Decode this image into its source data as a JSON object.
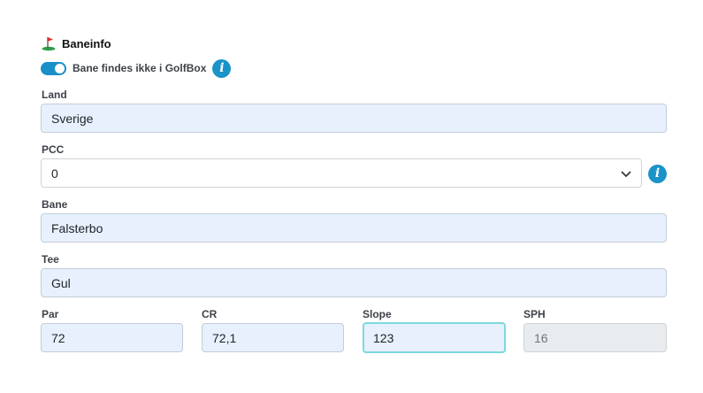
{
  "section": {
    "title": "Baneinfo",
    "icon": "golf-flag-icon"
  },
  "toggle": {
    "label": "Bane findes ikke i GolfBox",
    "on": true
  },
  "fields": {
    "land": {
      "label": "Land",
      "value": "Sverige"
    },
    "pcc": {
      "label": "PCC",
      "value": "0"
    },
    "bane": {
      "label": "Bane",
      "value": "Falsterbo"
    },
    "tee": {
      "label": "Tee",
      "value": "Gul"
    },
    "par": {
      "label": "Par",
      "value": "72"
    },
    "cr": {
      "label": "CR",
      "value": "72,1"
    },
    "slope": {
      "label": "Slope",
      "value": "123"
    },
    "sph": {
      "label": "SPH",
      "value": "16"
    }
  },
  "info_icon_glyph": "i",
  "colors": {
    "accent": "#1a93c8",
    "field_bg": "#e8f0fe",
    "focus_border": "#7ad9de",
    "disabled_bg": "#e9ecef"
  }
}
